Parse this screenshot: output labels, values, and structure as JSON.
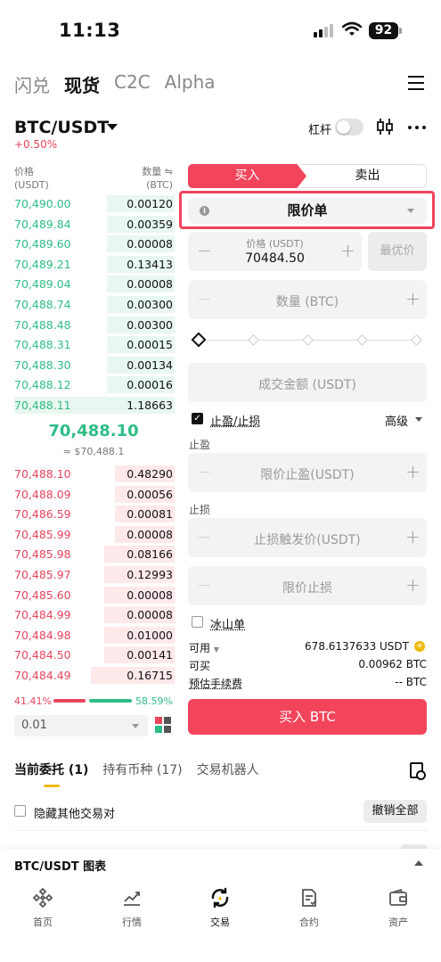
{
  "status_bar": {
    "time": "11:13",
    "battery": "92"
  },
  "top_tabs": [
    {
      "label": "闪兑",
      "active": false
    },
    {
      "label": "现货",
      "active": true
    },
    {
      "label": "C2C",
      "active": false
    },
    {
      "label": "Alpha",
      "active": false
    }
  ],
  "pair": {
    "symbol": "BTC/USDT",
    "change": "+0.50%",
    "leverage_label": "杠杆",
    "leverage_on": false
  },
  "orderbook": {
    "price_header": "价格",
    "price_unit": "(USDT)",
    "qty_header": "数量 ⇋",
    "qty_unit": "(BTC)",
    "bids": [
      {
        "price": "70,490.00",
        "qty": "0.00120",
        "depth": 0.42
      },
      {
        "price": "70,489.84",
        "qty": "0.00359",
        "depth": 0.42
      },
      {
        "price": "70,489.60",
        "qty": "0.00008",
        "depth": 0.42
      },
      {
        "price": "70,489.21",
        "qty": "0.13413",
        "depth": 0.42
      },
      {
        "price": "70,489.04",
        "qty": "0.00008",
        "depth": 0.42
      },
      {
        "price": "70,488.74",
        "qty": "0.00300",
        "depth": 0.42
      },
      {
        "price": "70,488.48",
        "qty": "0.00300",
        "depth": 0.42
      },
      {
        "price": "70,488.31",
        "qty": "0.00015",
        "depth": 0.42
      },
      {
        "price": "70,488.30",
        "qty": "0.00134",
        "depth": 0.42
      },
      {
        "price": "70,488.12",
        "qty": "0.00016",
        "depth": 0.42
      },
      {
        "price": "70,488.11",
        "qty": "1.18663",
        "depth": 1.0
      }
    ],
    "mid_price": "70,488.10",
    "mid_usd": "≈ $70,488.1",
    "asks": [
      {
        "price": "70,488.10",
        "qty": "0.48290",
        "depth": 0.37
      },
      {
        "price": "70,488.09",
        "qty": "0.00056",
        "depth": 0.37
      },
      {
        "price": "70,486.59",
        "qty": "0.00081",
        "depth": 0.37
      },
      {
        "price": "70,485.99",
        "qty": "0.00008",
        "depth": 0.37
      },
      {
        "price": "70,485.98",
        "qty": "0.08166",
        "depth": 0.44
      },
      {
        "price": "70,485.97",
        "qty": "0.12993",
        "depth": 0.44
      },
      {
        "price": "70,485.60",
        "qty": "0.00008",
        "depth": 0.44
      },
      {
        "price": "70,484.99",
        "qty": "0.00008",
        "depth": 0.44
      },
      {
        "price": "70,484.98",
        "qty": "0.01000",
        "depth": 0.44
      },
      {
        "price": "70,484.50",
        "qty": "0.00141",
        "depth": 0.44
      },
      {
        "price": "70,484.49",
        "qty": "0.16715",
        "depth": 0.52
      }
    ],
    "sell_ratio": "41.41%",
    "buy_ratio": "58.59%",
    "precision": "0.01"
  },
  "trade": {
    "buy_tab": "买入",
    "sell_tab": "卖出",
    "order_type": "限价单",
    "price_label": "价格 (USDT)",
    "price_value": "70484.50",
    "best_price": "最优价",
    "qty_placeholder": "数量 (BTC)",
    "total_placeholder": "成交金额 (USDT)",
    "tpsl_label": "止盈/止损",
    "tpsl_checked": true,
    "advanced_label": "高级",
    "tp_section": "止盈",
    "tp_placeholder": "限价止盈(USDT)",
    "sl_section": "止损",
    "sl_trigger_placeholder": "止损触发价(USDT)",
    "sl_limit_placeholder": "限价止损",
    "iceberg_label": "冰山单",
    "available_label": "可用",
    "available_value": "678.6137633 USDT",
    "can_buy_label": "可买",
    "can_buy_value": "0.00962 BTC",
    "fee_label": "预估手续费",
    "fee_value": "-- BTC",
    "buy_button": "买入 BTC"
  },
  "orders": {
    "tabs": [
      {
        "label": "当前委托 (1)",
        "active": true
      },
      {
        "label": "持有币种 (17)",
        "active": false
      },
      {
        "label": "交易机器人",
        "active": false
      }
    ],
    "hide_other_pairs": "隐藏其他交易对",
    "cancel_all": "撤销全部"
  },
  "chart_bar": {
    "label": "BTC/USDT 图表"
  },
  "bottom_nav": [
    {
      "label": "首页",
      "icon": "home-diamond-icon"
    },
    {
      "label": "行情",
      "icon": "market-chart-icon"
    },
    {
      "label": "交易",
      "icon": "trade-swap-icon"
    },
    {
      "label": "合约",
      "icon": "futures-doc-icon"
    },
    {
      "label": "资产",
      "icon": "wallet-icon"
    }
  ],
  "colors": {
    "green": "#2ebd85",
    "red": "#e8445c",
    "buy": "#f2455c",
    "accent": "#f0b90b"
  }
}
